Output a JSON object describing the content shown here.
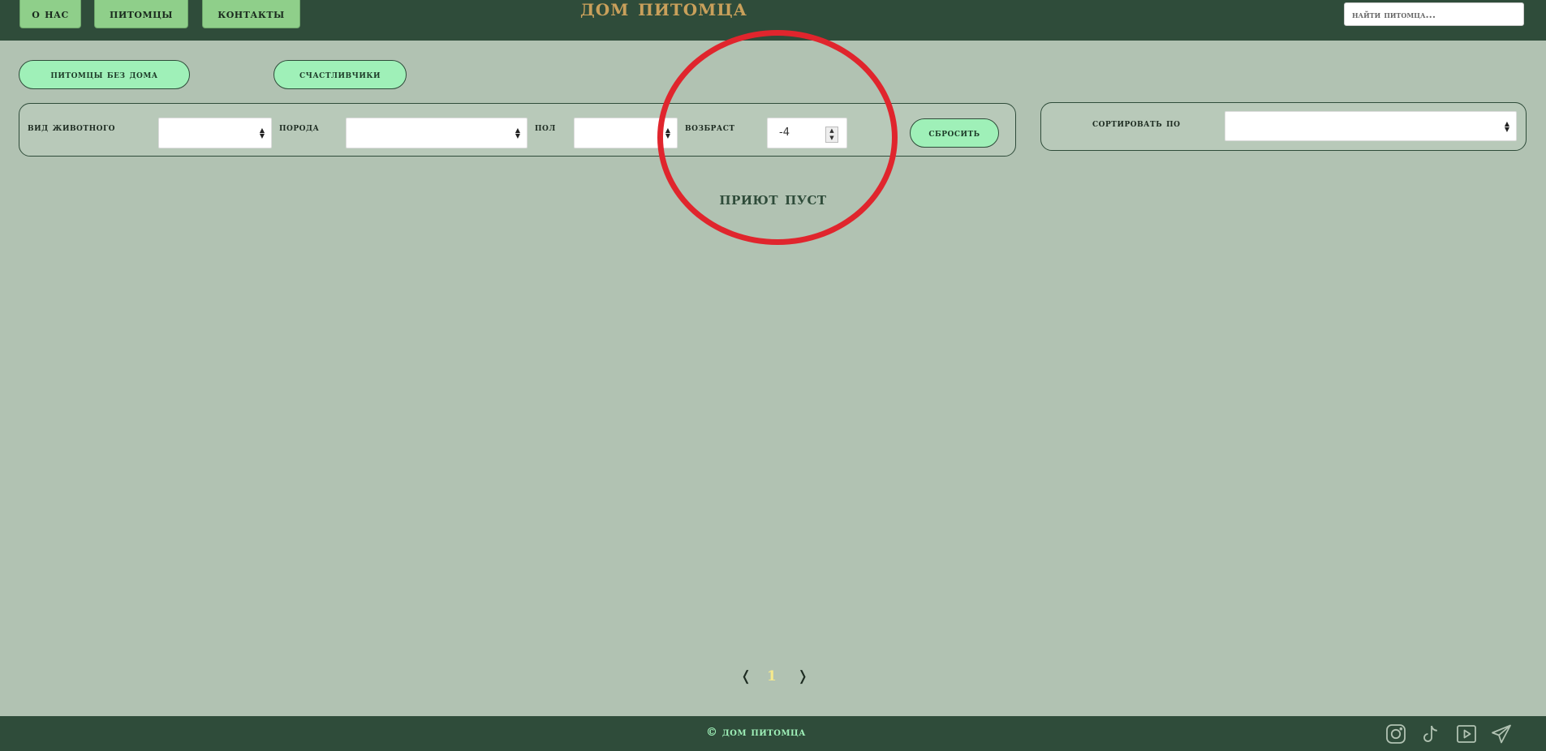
{
  "header": {
    "nav": [
      "о нас",
      "питомцы",
      "контакты"
    ],
    "brand": "дом питомца",
    "search_placeholder": "найти питомца..."
  },
  "categories": [
    "питомцы без дома",
    "счастливчики"
  ],
  "filters": {
    "species_label": "вид животного",
    "species_value": "",
    "breed_label": "порода",
    "breed_value": "",
    "sex_label": "пол",
    "sex_value": "",
    "age_label": "возбраст",
    "age_value": "-4",
    "reset_label": "сбросить"
  },
  "sort": {
    "label": "сортировать по",
    "value": ""
  },
  "empty_message": "приют пуст",
  "pagination": {
    "prev": "❬",
    "current": "1",
    "next": "❭"
  },
  "footer": {
    "copyright": "© дом питомца",
    "icons": [
      "instagram-icon",
      "tiktok-icon",
      "youtube-icon",
      "telegram-icon"
    ]
  },
  "colors": {
    "header_bg": "#2f4c3a",
    "page_bg": "#b1c2b2",
    "accent": "#9ff0b8",
    "brand": "#c9a05b",
    "annotation": "#e0252d"
  }
}
